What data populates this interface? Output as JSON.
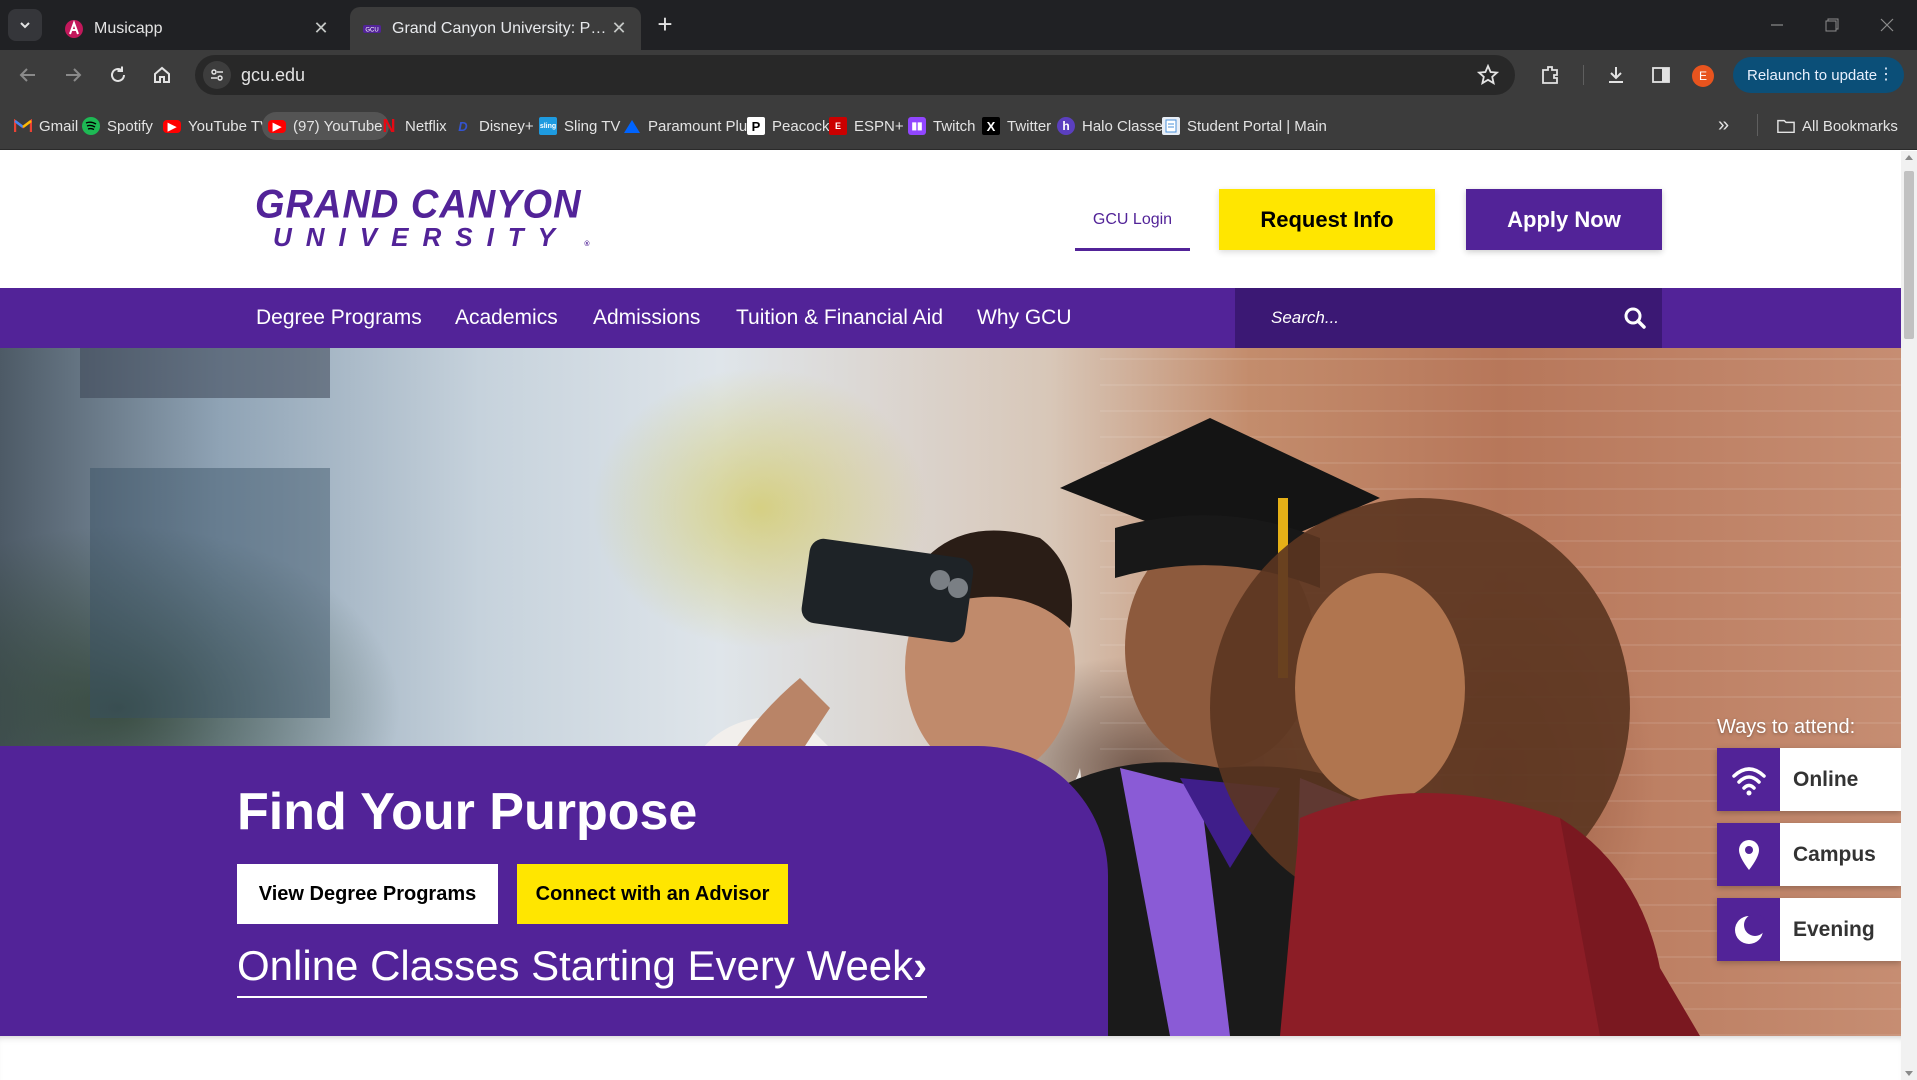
{
  "browser": {
    "tabs": [
      {
        "title": "Musicapp",
        "active": false
      },
      {
        "title": "Grand Canyon University: Privat",
        "active": true
      }
    ],
    "url": "gcu.edu",
    "profile_initial": "E",
    "relaunch_label": "Relaunch to update",
    "bookmarks": [
      {
        "label": "Gmail",
        "icon": "gmail-icon",
        "color": "#ea4335"
      },
      {
        "label": "Spotify",
        "icon": "spotify-icon",
        "color": "#1db954"
      },
      {
        "label": "YouTube TV",
        "icon": "youtube-tv-icon",
        "color": "#ff0000"
      },
      {
        "label": "(97) YouTube",
        "icon": "youtube-icon",
        "color": "#ff0000"
      },
      {
        "label": "Netflix",
        "icon": "netflix-icon",
        "color": "#e50914"
      },
      {
        "label": "Disney+",
        "icon": "disney-icon",
        "color": "#1a3aa8"
      },
      {
        "label": "Sling TV",
        "icon": "sling-icon",
        "color": "#1e9be0"
      },
      {
        "label": "Paramount Plus",
        "icon": "paramount-icon",
        "color": "#0064ff"
      },
      {
        "label": "Peacock",
        "icon": "peacock-icon",
        "color": "#000000"
      },
      {
        "label": "ESPN+",
        "icon": "espn-icon",
        "color": "#cc0000"
      },
      {
        "label": "Twitch",
        "icon": "twitch-icon",
        "color": "#9146ff"
      },
      {
        "label": "Twitter",
        "icon": "x-icon",
        "color": "#000000"
      },
      {
        "label": "Halo Classes",
        "icon": "halo-icon",
        "color": "#5b3fbf"
      },
      {
        "label": "Student Portal | Main",
        "icon": "portal-icon",
        "color": "#4a90d9"
      }
    ],
    "all_bookmarks_label": "All Bookmarks"
  },
  "site": {
    "logo": {
      "line1": "GRAND CANYON",
      "line2": "UNIVERSITY",
      "reg": "®"
    },
    "header": {
      "login_label": "GCU Login",
      "request_label": "Request Info",
      "apply_label": "Apply Now"
    },
    "nav": {
      "items": [
        "Degree Programs",
        "Academics",
        "Admissions",
        "Tuition & Financial Aid",
        "Why GCU"
      ],
      "search_placeholder": "Search..."
    },
    "hero": {
      "title": "Find Your Purpose",
      "primary_button": "View Degree Programs",
      "secondary_button": "Connect with an Advisor",
      "link_text": "Online Classes Starting Every Week",
      "link_chevron": "›"
    },
    "attend": {
      "label": "Ways to attend:",
      "options": [
        {
          "label": "Online",
          "icon": "wifi-icon"
        },
        {
          "label": "Campus",
          "icon": "map-pin-icon"
        },
        {
          "label": "Evening",
          "icon": "moon-icon"
        }
      ]
    }
  },
  "colors": {
    "brand_purple": "#522398",
    "brand_yellow": "#ffe600",
    "chrome_dark": "#202124",
    "chrome_toolbar": "#3c3c3c"
  }
}
